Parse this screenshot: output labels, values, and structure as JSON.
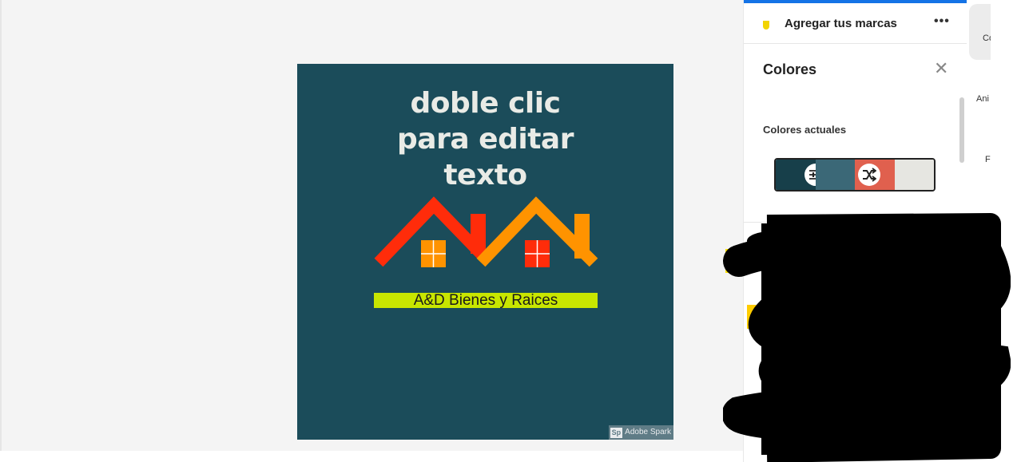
{
  "artboard": {
    "headline_lines": [
      "doble clic",
      "para editar",
      "texto"
    ],
    "brand_text": "A&D Bienes y Raices",
    "watermark_logo": "Sp",
    "watermark_text": "Adobe Spark",
    "background_color": "#1b4c5a"
  },
  "panel": {
    "brand_label": "Agregar tus marcas",
    "more_label": "•••",
    "colors_title": "Colores",
    "close_label": "✕",
    "current_colors_label": "Colores actuales",
    "palette": [
      "#173f4a",
      "#3b6877",
      "#e0604e",
      "#e6e6e1"
    ]
  },
  "rail": {
    "items": [
      "Co",
      "Ani",
      "Fu"
    ]
  },
  "colors": {
    "accent": "#1473e6",
    "roof_left": "#ff2c0a",
    "roof_right": "#ff9300",
    "brand_bar": "#c8e600"
  }
}
